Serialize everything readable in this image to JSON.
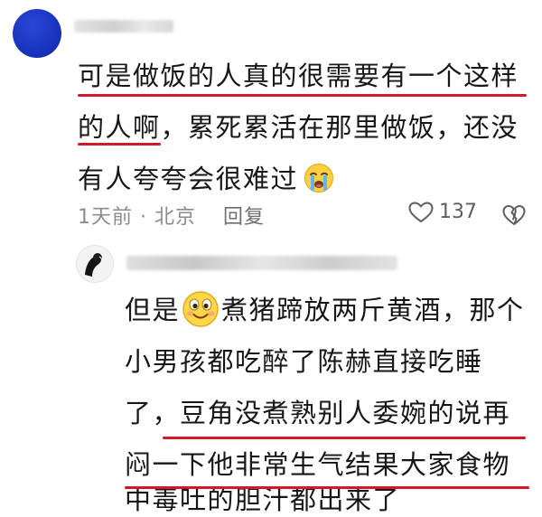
{
  "main_comment": {
    "line1": "可是做饭的人真的很需要有一个这样",
    "line2": "的人啊，累死累活在那里做饭，还没",
    "line3": "有人夸夸会很难过",
    "emoji": "crying-face-icon",
    "time": "1天前",
    "separator": "·",
    "location": "北京",
    "reply_label": "回复",
    "like_count": "137",
    "accent_color": "#d0192a",
    "avatar_color": "#1630b8"
  },
  "reply_comment": {
    "line1_pre": "但是",
    "line1_emoji": "smiling-face-icon",
    "line1_post": "煮猪蹄放两斤黄酒，那个",
    "line2": "小男孩都吃醉了陈赫直接吃睡",
    "line3": "了，豆角没煮熟别人委婉的说再",
    "line4": "闷一下他非常生气结果大家食物",
    "line5": "中毒吐的胆汁都出来了"
  }
}
